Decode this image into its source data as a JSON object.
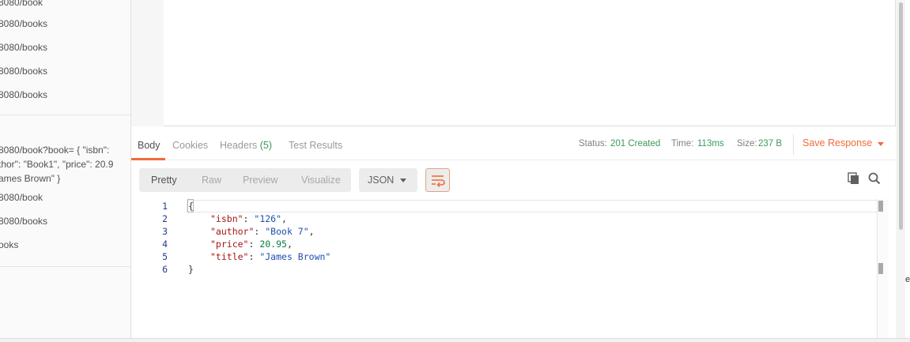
{
  "sidebar": {
    "history": [
      {
        "text": "8080/book"
      },
      {
        "text": "8080/books"
      },
      {
        "text": "8080/books"
      },
      {
        "text": "8080/books"
      },
      {
        "text": "8080/books"
      }
    ],
    "history_multi": {
      "line1": "8080/book?book= { \"isbn\":",
      "line2": "thor\": \"Book1\", \"price\": 20.9",
      "line3": "ames Brown\" }"
    },
    "history2": [
      {
        "text": "8080/book"
      },
      {
        "text": "8080/books"
      },
      {
        "text": "ooks"
      }
    ]
  },
  "response_tabs": {
    "body": "Body",
    "cookies": "Cookies",
    "headers": "Headers",
    "headers_count": "(5)",
    "test_results": "Test Results"
  },
  "response_meta": {
    "status_label": "Status:",
    "status_value": "201 Created",
    "time_label": "Time:",
    "time_value": "113ms",
    "size_label": "Size:",
    "size_value": "237 B",
    "save_response": "Save Response"
  },
  "view_modes": {
    "pretty": "Pretty",
    "raw": "Raw",
    "preview": "Preview",
    "visualize": "Visualize",
    "format": "JSON"
  },
  "editor": {
    "line_numbers": [
      "1",
      "2",
      "3",
      "4",
      "5",
      "6"
    ],
    "open_brace": "{",
    "close_brace": "}",
    "fields": [
      {
        "key": "\"isbn\"",
        "value": "\"126\"",
        "type": "string",
        "comma": ","
      },
      {
        "key": "\"author\"",
        "value": "\"Book 7\"",
        "type": "string",
        "comma": ","
      },
      {
        "key": "\"price\"",
        "value": "20.95",
        "type": "number",
        "comma": ","
      },
      {
        "key": "\"title\"",
        "value": "\"James Brown\"",
        "type": "string",
        "comma": ""
      }
    ]
  },
  "edge_glyph": "e",
  "colors": {
    "accent": "#f26b3a",
    "success": "#3b9a57",
    "json_key": "#a31515",
    "json_string": "#1f4fb0",
    "json_number": "#0a7a4a"
  },
  "icons": {
    "wrap": "wrap-lines-icon",
    "copy": "copy-icon",
    "search": "search-icon",
    "format_caret": "chevron-down-icon",
    "save_caret": "chevron-down-icon"
  }
}
